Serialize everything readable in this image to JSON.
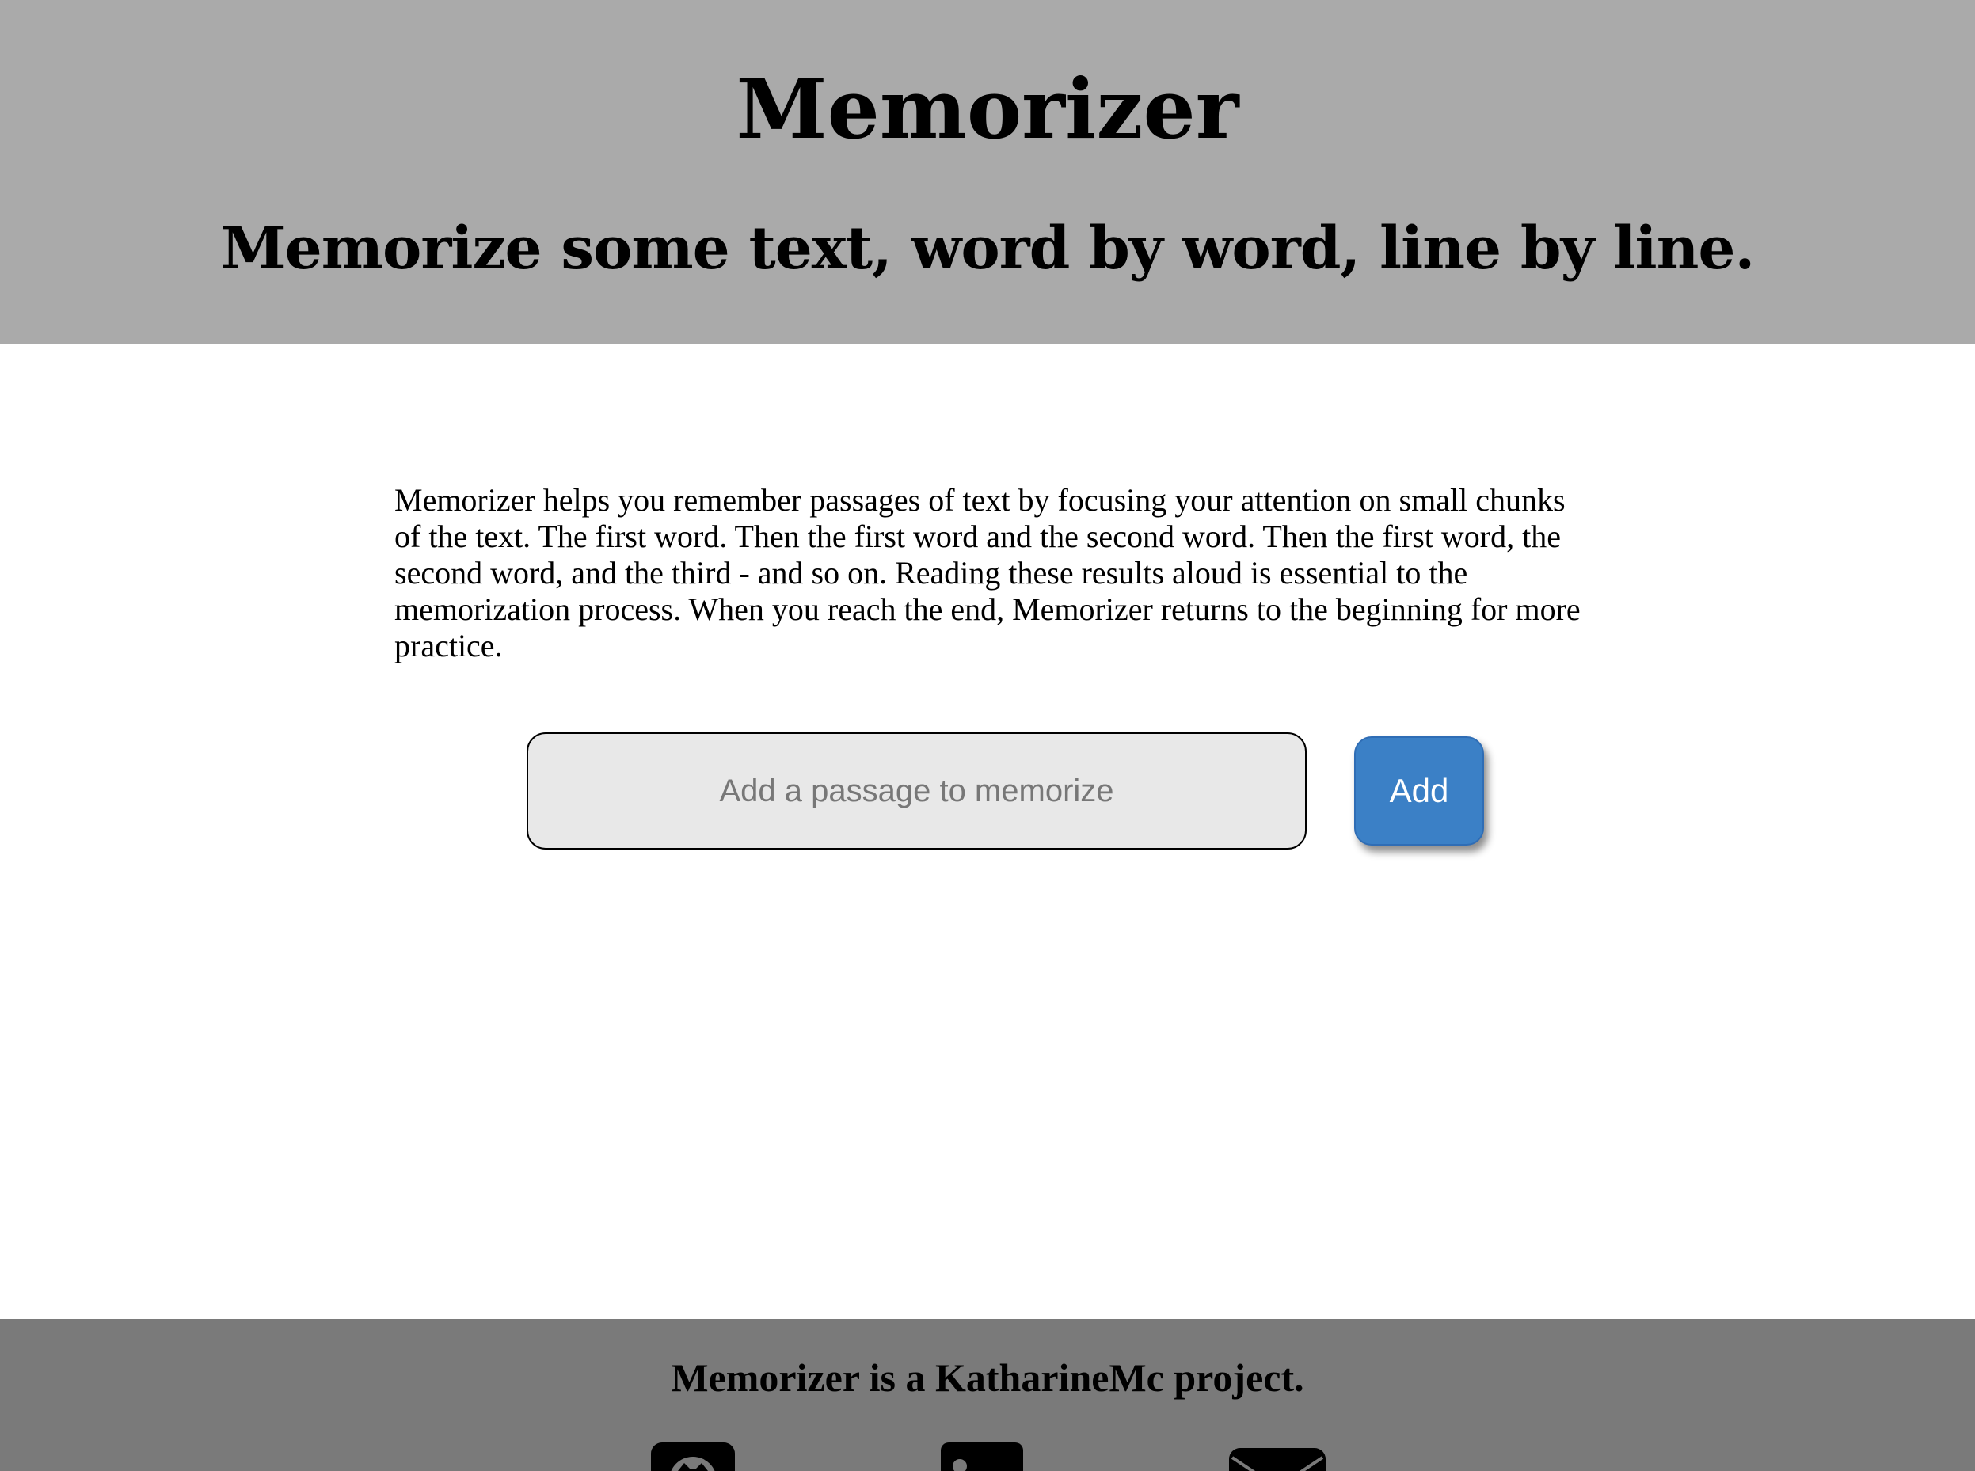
{
  "header": {
    "title": "Memorizer",
    "subtitle": "Memorize some text, word by word, line by line."
  },
  "main": {
    "description": "Memorizer helps you remember passages of text by focusing your attention on small chunks of the text. The first word. Then the first word and the second word. Then the first word, the second word, and the third - and so on. Reading these results aloud is essential to the memorization process. When you reach the end, Memorizer returns to the beginning for more practice.",
    "passage_input": {
      "value": "",
      "placeholder": "Add a passage to memorize"
    },
    "add_button_label": "Add"
  },
  "footer": {
    "text": "Memorizer is a KatharineMc project.",
    "icons": [
      "github-icon",
      "linkedin-icon",
      "email-icon"
    ]
  },
  "colors": {
    "header_bg": "#aaaaaa",
    "footer_bg": "#7a7a7a",
    "input_bg": "#e8e8e8",
    "accent": "#3b80c6"
  }
}
